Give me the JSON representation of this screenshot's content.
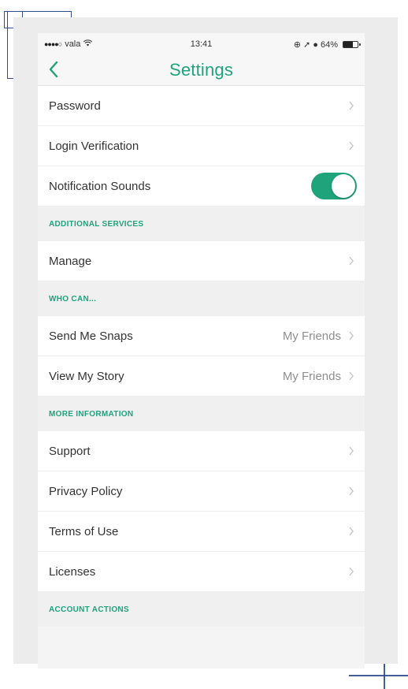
{
  "status_bar": {
    "carrier": "vala",
    "signal": "●●●●○",
    "wifi_icon": "wifi-icon",
    "time": "13:41",
    "right": "⊕ ➚ ● 64%",
    "battery_level": 0.64
  },
  "nav": {
    "title": "Settings",
    "back_icon": "chevron-left-icon"
  },
  "colors": {
    "accent": "#1fa37a",
    "text": "#333333",
    "secondary": "#8e8e8e",
    "section_bg": "#f0f0f0"
  },
  "items": {
    "password": "Password",
    "login_verification": "Login Verification",
    "notification_sounds": "Notification Sounds",
    "notification_sounds_on": true
  },
  "sections": {
    "additional_services": "ADDITIONAL SERVICES",
    "who_can": "WHO CAN...",
    "more_information": "MORE INFORMATION",
    "account_actions": "ACCOUNT ACTIONS"
  },
  "additional_services_items": {
    "manage": "Manage"
  },
  "who_can_items": {
    "send_me_snaps": "Send Me Snaps",
    "send_me_snaps_value": "My Friends",
    "view_my_story": "View My Story",
    "view_my_story_value": "My Friends"
  },
  "more_information_items": {
    "support": "Support",
    "privacy_policy": "Privacy Policy",
    "terms_of_use": "Terms of Use",
    "licenses": "Licenses"
  }
}
